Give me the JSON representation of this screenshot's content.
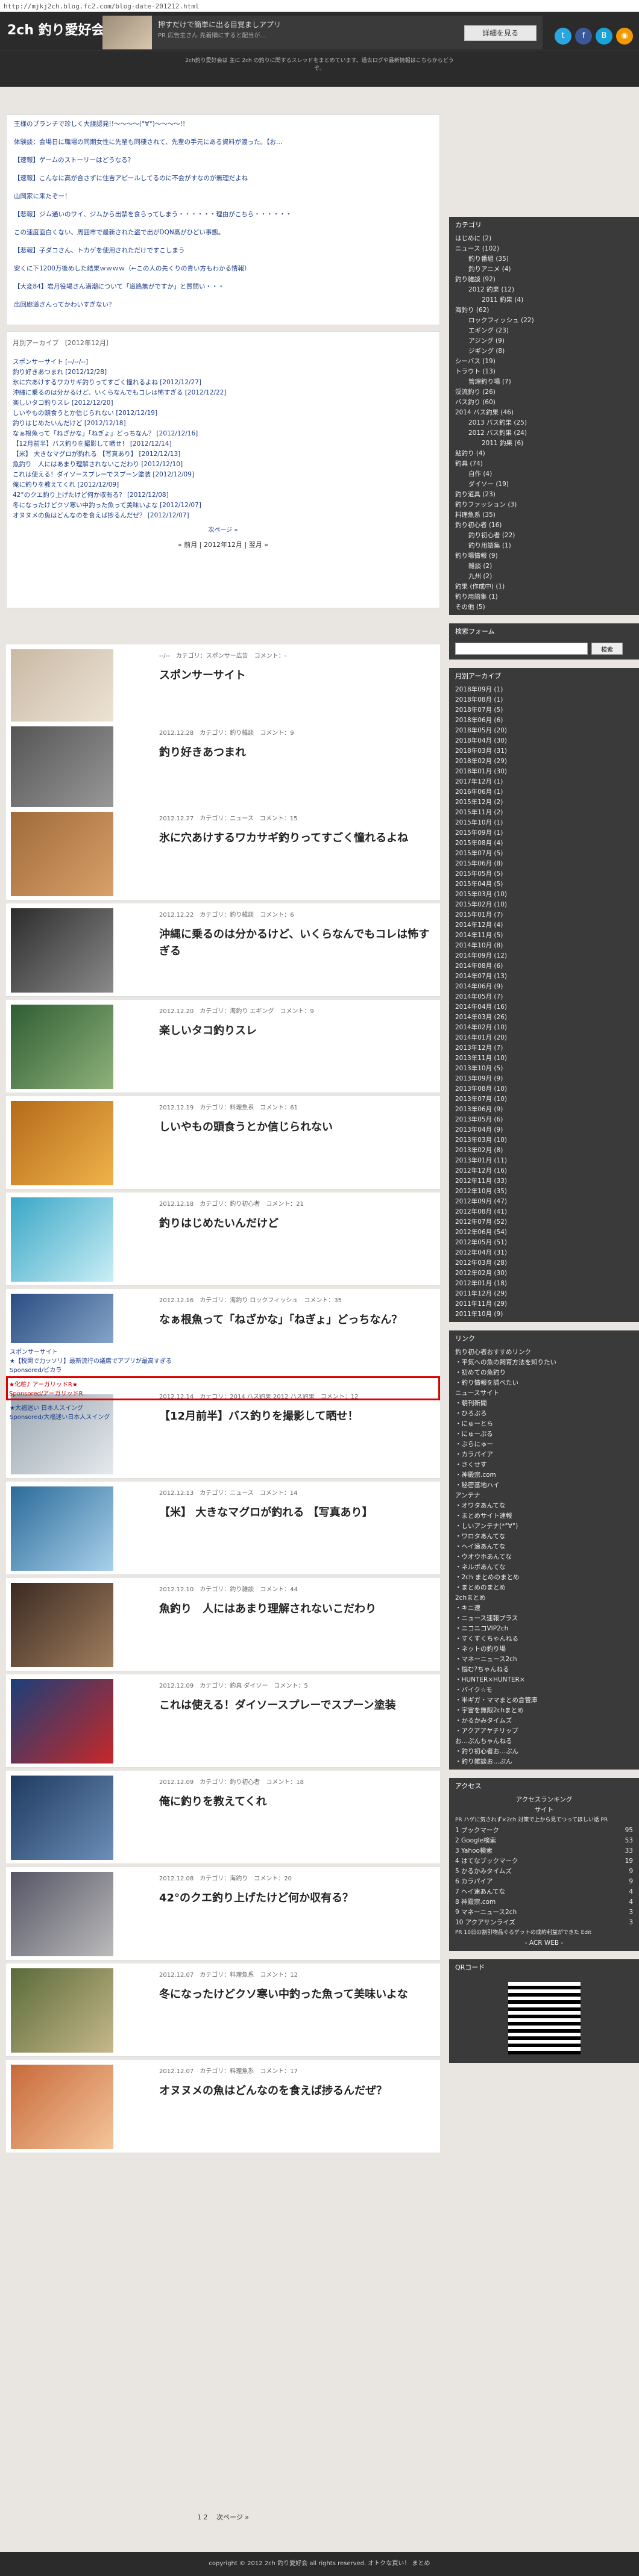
{
  "url": "http://mjkj2ch.blog.fc2.com/blog-date-201212.html",
  "site_title": "2ch 釣り愛好会",
  "header_ad": {
    "title": "押すだけで簡単に出る目覚ましアプリ",
    "desc": "PR 広告主さん 先着順にすると配当が…",
    "button": "詳細を見る"
  },
  "subhead": "2ch釣り愛好会は 主に 2ch の釣りに関するスレッドをまとめています。過去ログや最新情報はこちらからどうぞ。",
  "ticker": [
    "王様のブランチで珍しく大誤認発!!〜〜〜〜(°∀°)〜〜〜〜!!",
    "体験談：会場日に職場の同期女性に先輩も同棲されて、先輩の手元にある資料が渡った。【お…",
    "【速報】ゲームのストーリーはどうなる？",
    "【速報】こんなに高が合さずに住吉アピールしてるのに不会がすなのが無理だよね",
    "山岡家に来たぞー！",
    "【悲報】ジム通いのワイ、ジムから出禁を食らってしまう・・・・・・理由がこちら・・・・・・",
    "この速度面白くない、周囲市で最新された盗で出がDQN高がひどい事態。",
    "【悲報】子ダコさん、トカゲを使用されただけですこしまう",
    "安くに下1200万後めした結果ｗｗｗｗ（←この人の先くりの青い方もわかる情報）",
    "【大変84】岩月役場さん満潮について「道路無がですか」と質問い・・・",
    "出回廊道さんってかわいすぎない？"
  ],
  "archive": {
    "heading": "月別アーカイブ 〔2012年12月〕",
    "items": [
      "スポンサーサイト [--/--/--]",
      "釣り好きあつまれ [2012/12/28]",
      "氷に穴あけするワカサギ釣りってすごく憧れるよね [2012/12/27]",
      "沖縄に乗るのは分かるけど、いくらなんでもコレは怖すぎる [2012/12/22]",
      "楽しいタコ釣りスレ [2012/12/20]",
      "しいやもの頭食うとか信じられない [2012/12/19]",
      "釣りはじめたいんだけど [2012/12/18]",
      "なぁ根魚って「ねざかな」「ねぎょ」どっちなん？ [2012/12/16]",
      "【12月前半】バス釣りを撮影して晒せ！ [2012/12/14]",
      "【米】 大きなマグロが釣れる 【写真あり】 [2012/12/13]",
      "魚釣り　人にはあまり理解されないこだわり [2012/12/10]",
      "これは使える！ダイソースプレーでスプーン塗装 [2012/12/09]",
      "俺に釣りを教えてくれ [2012/12/09]",
      "42°のクエ釣り上げたけど何か収有る？ [2012/12/08]",
      "冬になったけどクソ寒い中釣った魚って美味いよな [2012/12/07]",
      "オヌヌメの魚はどんなのを食えば捗るんだぜ？ [2012/12/07]"
    ],
    "more": "次ページ »",
    "nav": "« 前月 | 2012年12月 | 翌月 »"
  },
  "posts": [
    {
      "meta": "--/--　カテゴリ：スポンサー広告　コメント：-",
      "title": "スポンサーサイト"
    },
    {
      "meta": "2012.12.28　カテゴリ：釣り雑談　コメント：9",
      "title": "釣り好きあつまれ"
    },
    {
      "meta": "2012.12.27　カテゴリ：ニュース　コメント：15",
      "title": "氷に穴あけするワカサギ釣りってすごく憧れるよね"
    },
    {
      "meta": "2012.12.22　カテゴリ：釣り雑談　コメント：6",
      "title": "沖縄に乗るのは分かるけど、いくらなんでもコレは怖すぎる"
    },
    {
      "meta": "2012.12.20　カテゴリ：海釣り エギング　コメント：9",
      "title": "楽しいタコ釣りスレ"
    },
    {
      "meta": "2012.12.19　カテゴリ：料理魚系　コメント：61",
      "title": "しいやもの頭食うとか信じられない"
    },
    {
      "meta": "2012.12.18　カテゴリ：釣り初心者　コメント：21",
      "title": "釣りはじめたいんだけど"
    },
    {
      "meta": "2012.12.16　カテゴリ：海釣り ロックフィッシュ　コメント：35",
      "title": "なぁ根魚って「ねざかな」「ねぎょ」どっちなん？"
    },
    {
      "meta": "2012.12.14　カテゴリ：2014 バス釣果 2012 バス釣果　コメント：12",
      "title": "【12月前半】バス釣りを撮影して晒せ！"
    },
    {
      "meta": "2012.12.13　カテゴリ：ニュース　コメント：14",
      "title": "【米】 大きなマグロが釣れる 【写真あり】"
    },
    {
      "meta": "2012.12.10　カテゴリ：釣り雑談　コメント：44",
      "title": "魚釣り　人にはあまり理解されないこだわり"
    },
    {
      "meta": "2012.12.09　カテゴリ：釣具 ダイソー　コメント：5",
      "title": "これは使える！ダイソースプレーでスプーン塗装"
    },
    {
      "meta": "2012.12.09　カテゴリ：釣り初心者　コメント：18",
      "title": "俺に釣りを教えてくれ"
    },
    {
      "meta": "2012.12.08　カテゴリ：海釣り　コメント：20",
      "title": "42°のクエ釣り上げたけど何か収有る？"
    },
    {
      "meta": "2012.12.07　カテゴリ：料理魚系　コメント：12",
      "title": "冬になったけどクソ寒い中釣った魚って美味いよな"
    },
    {
      "meta": "2012.12.07　カテゴリ：料理魚系　コメント：17",
      "title": "オヌヌメの魚はどんなのを食えば捗るんだぜ？"
    }
  ],
  "sponsor": {
    "label": "スポンサーサイト",
    "l1": "★【税関で力ッソリ】最新流行の議席でアプリが最高すぎる",
    "l1b": "Sponsored/ビカラ",
    "l2": "★化粧♪ アーガリッドR★",
    "l2b": "Sponsored/アーガリッドR",
    "l3": "★大福迷い 日本人スイング",
    "l3b": "Sponsored/大福迷い日本人スイング"
  },
  "pager": "1 2　 次ページ »",
  "footer": "copyright © 2012 2ch 釣り愛好会 all rights reserved. オトクな買い！ まとめ",
  "sidebar": {
    "cat_head": "カテゴリ",
    "cats": [
      {
        "t": "はじめに (2)",
        "l": 0
      },
      {
        "t": "ニュース (102)",
        "l": 0
      },
      {
        "t": "釣り番組 (35)",
        "l": 1
      },
      {
        "t": "釣りアニメ (4)",
        "l": 1
      },
      {
        "t": "釣り雑談 (92)",
        "l": 0
      },
      {
        "t": "2012 釣果 (12)",
        "l": 1
      },
      {
        "t": "2011 釣果 (4)",
        "l": 2
      },
      {
        "t": "海釣り (62)",
        "l": 0
      },
      {
        "t": "ロックフィッシュ (22)",
        "l": 1
      },
      {
        "t": "エギング (23)",
        "l": 1
      },
      {
        "t": "アジング (9)",
        "l": 1
      },
      {
        "t": "ジギング (8)",
        "l": 1
      },
      {
        "t": "シーバス (19)",
        "l": 0
      },
      {
        "t": "トラウト (13)",
        "l": 0
      },
      {
        "t": "管理釣り場 (7)",
        "l": 1
      },
      {
        "t": "渓流釣り (26)",
        "l": 0
      },
      {
        "t": "バス釣り (60)",
        "l": 0
      },
      {
        "t": "2014 バス釣果 (46)",
        "l": 0
      },
      {
        "t": "2013 バス釣果 (25)",
        "l": 1
      },
      {
        "t": "2012 バス釣果 (24)",
        "l": 1
      },
      {
        "t": "2011 釣果 (6)",
        "l": 2
      },
      {
        "t": "鮎釣り (4)",
        "l": 0
      },
      {
        "t": "釣具 (74)",
        "l": 0
      },
      {
        "t": "自作 (4)",
        "l": 1
      },
      {
        "t": "ダイソー (19)",
        "l": 1
      },
      {
        "t": "釣り道具 (23)",
        "l": 0
      },
      {
        "t": "釣りファッション (3)",
        "l": 0
      },
      {
        "t": "料理魚系 (35)",
        "l": 0
      },
      {
        "t": "釣り初心者 (16)",
        "l": 0
      },
      {
        "t": "釣り初心者 (22)",
        "l": 1
      },
      {
        "t": "釣り用語集 (1)",
        "l": 1
      },
      {
        "t": "釣り場情報 (9)",
        "l": 0
      },
      {
        "t": "雑談 (2)",
        "l": 1
      },
      {
        "t": "九州 (2)",
        "l": 1
      },
      {
        "t": "釣果 (作成中) (1)",
        "l": 0
      },
      {
        "t": "釣り用語集 (1)",
        "l": 0
      },
      {
        "t": "その他 (5)",
        "l": 0
      }
    ],
    "search_head": "検索フォーム",
    "search_btn": "検索",
    "month_head": "月別アーカイブ",
    "months": [
      "2018年09月 (1)",
      "2018年08月 (1)",
      "2018年07月 (5)",
      "2018年06月 (6)",
      "2018年05月 (20)",
      "2018年04月 (30)",
      "2018年03月 (31)",
      "2018年02月 (29)",
      "2018年01月 (30)",
      "2017年12月 (1)",
      "2016年06月 (1)",
      "2015年12月 (2)",
      "2015年11月 (2)",
      "2015年10月 (1)",
      "2015年09月 (1)",
      "2015年08月 (4)",
      "2015年07月 (5)",
      "2015年06月 (8)",
      "2015年05月 (5)",
      "2015年04月 (5)",
      "2015年03月 (10)",
      "2015年02月 (10)",
      "2015年01月 (7)",
      "2014年12月 (4)",
      "2014年11月 (5)",
      "2014年10月 (8)",
      "2014年09月 (12)",
      "2014年08月 (6)",
      "2014年07月 (13)",
      "2014年06月 (9)",
      "2014年05月 (7)",
      "2014年04月 (16)",
      "2014年03月 (26)",
      "2014年02月 (10)",
      "2014年01月 (20)",
      "2013年12月 (7)",
      "2013年11月 (10)",
      "2013年10月 (5)",
      "2013年09月 (9)",
      "2013年08月 (10)",
      "2013年07月 (10)",
      "2013年06月 (9)",
      "2013年05月 (6)",
      "2013年04月 (9)",
      "2013年03月 (10)",
      "2013年02月 (8)",
      "2013年01月 (11)",
      "2012年12月 (16)",
      "2012年11月 (33)",
      "2012年10月 (35)",
      "2012年09月 (47)",
      "2012年08月 (41)",
      "2012年07月 (52)",
      "2012年06月 (54)",
      "2012年05月 (51)",
      "2012年04月 (31)",
      "2012年03月 (28)",
      "2012年02月 (30)",
      "2012年01月 (18)",
      "2011年12月 (29)",
      "2011年11月 (29)",
      "2011年10月 (9)"
    ],
    "link_head": "リンク",
    "links": [
      "釣り初心者おすすめリンク",
      "・平気への魚の飼育方法を知りたい",
      "・初めての魚釣り",
      "・釣り情報を調べたい",
      "ニュースサイト",
      "・朝刊新聞",
      "・ひろぶろ",
      "・にゅーとら",
      "・にゅーぷる",
      "・ぶらにゅー",
      "・カラパイア",
      "・さくせす",
      "・神殿宗.com",
      "・秘密基地ハイ",
      "アンテナ",
      "・オワタあんてな",
      "・まとめサイト速報",
      "・しいアンテナ(*°∀°)",
      "・ワロタあんてな",
      "・ヘイ速あんてな",
      "・ウオウホあんてな",
      "・ネルボあんてな",
      "・2ch まとめのまとめ",
      "・まとめのまとめ",
      "2chまとめ",
      "・キニ速",
      "・ニュース速報プラス",
      "・ニコニコVIP2ch",
      "・すくすくちゃんねる",
      "・ネットの釣り場",
      "・マネーニュース2ch",
      "・悩む?ちゃんねる",
      "・HUNTER×HUNTER×",
      "・バイク☆モ",
      "・半ギガ・ママまとめ倉管庫",
      "・宇宙を無限2chまとめ",
      "・かるかみタイムズ",
      "・アクアアヤチリップ",
      "お…ぷんちゃんねる",
      "・釣り初心者お…ぷん",
      "・釣り雑談お…ぷん"
    ],
    "access_head": "アクセス",
    "access_title": "アクセスランキング",
    "access_sub": "サイト",
    "access_note": "PR ハゲに気されず×2ch 対策で上から見てつってほしい話 PR",
    "ranks": [
      [
        "1 ブックマーク",
        "95"
      ],
      [
        "2 Google検索",
        "53"
      ],
      [
        "3 Yahoo検索",
        "33"
      ],
      [
        "4 はてなブックマーク",
        "19"
      ],
      [
        "5 かるかみタイムズ",
        "9"
      ],
      [
        "6 カラパイア",
        "9"
      ],
      [
        "7 ヘイ速あんてな",
        "4"
      ],
      [
        "8 神殿宗.com",
        "4"
      ],
      [
        "9 マネーニュース2ch",
        "3"
      ],
      [
        "10 アクアサンライズ",
        "3"
      ]
    ],
    "access_foot": "PR 10日の割引物品ぐるゲットの成約利益ができた Edit",
    "access_web": "- ACR WEB -",
    "qr_head": "QRコード"
  },
  "colors": {
    "header": "#2b2b2b",
    "sidebar": "#3a3a3a",
    "twitter": "#2aa6e0",
    "facebook": "#3b5998",
    "hatena": "#1aa3d7",
    "rss": "#f39800"
  }
}
